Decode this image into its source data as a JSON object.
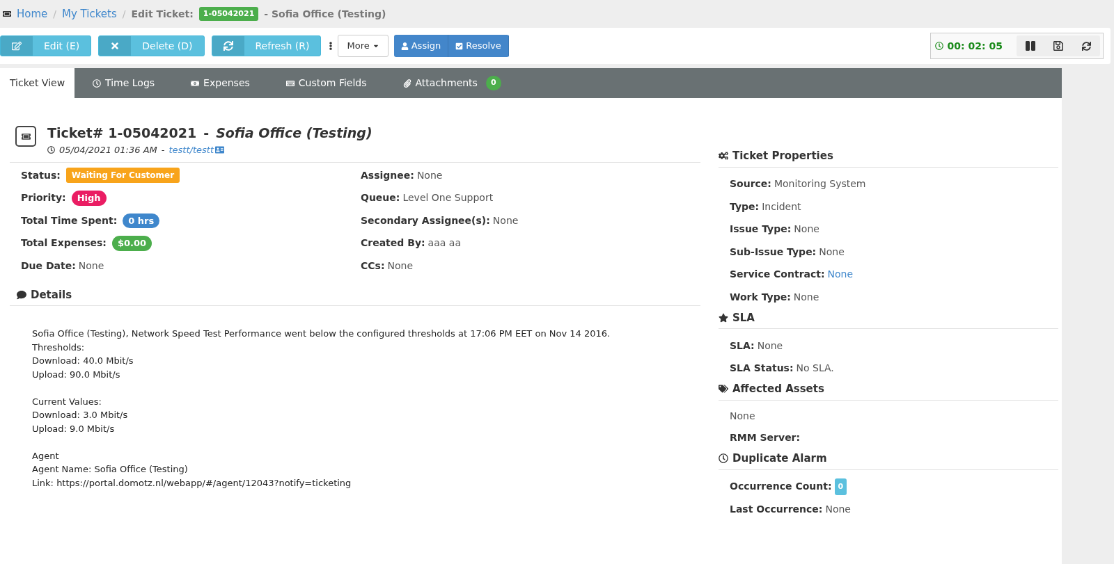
{
  "breadcrumb": {
    "items": [
      {
        "label": "Home",
        "separator": "/"
      },
      {
        "label": "My Tickets",
        "separator": "/"
      }
    ],
    "current_label": "Edit Ticket:",
    "ticket_badge": "1-05042021",
    "current_suffix": "- Sofia Office (Testing)"
  },
  "toolbar": {
    "buttons": [
      {
        "label": "Edit (E)",
        "kind": "edit"
      },
      {
        "label": "Delete (D)",
        "kind": "delete"
      },
      {
        "label": "Refresh (R)",
        "kind": "refresh"
      }
    ],
    "more": "More",
    "actions": [
      {
        "label": "Assign",
        "kind": "assign"
      },
      {
        "label": "Resolve",
        "kind": "resolve"
      }
    ],
    "timer": "00: 02: 05"
  },
  "tabs": [
    {
      "label": "Ticket View",
      "kind": "view",
      "selected": true
    },
    {
      "label": "Time Logs",
      "kind": "time",
      "selected": false
    },
    {
      "label": "Expenses",
      "kind": "money",
      "selected": false
    },
    {
      "label": "Custom Fields",
      "kind": "keyboard",
      "selected": false
    },
    {
      "label": "Attachments",
      "kind": "attach",
      "selected": false,
      "count": "0"
    }
  ],
  "ticket": {
    "title": "Ticket# 1-05042021",
    "separator": "-",
    "subject": "Sofia Office (Testing)",
    "date": "05/04/2021 01:36 AM",
    "date_separator": "-",
    "author": "testt/testt"
  },
  "fields_left": [
    {
      "label": "Status:",
      "value": "Waiting For Customer",
      "kind": "tag",
      "color": "#f8a41b"
    },
    {
      "label": "Priority:",
      "value": "High",
      "kind": "pill",
      "color": "#ea1d63"
    },
    {
      "label": "Total Time Spent:",
      "value": "0 hrs",
      "kind": "pill",
      "color": "#3f87cc"
    },
    {
      "label": "Total Expenses:",
      "value": "$0.00",
      "kind": "pill",
      "color": "#4cae4c"
    },
    {
      "label": "Due Date:",
      "value": "None",
      "kind": "text"
    }
  ],
  "fields_right": [
    {
      "label": "Assignee:",
      "value": "None",
      "kind": "text"
    },
    {
      "label": "Queue:",
      "value": "Level One Support",
      "kind": "text"
    },
    {
      "label": "Secondary Assignee(s):",
      "value": "None",
      "kind": "text"
    },
    {
      "label": "Created By:",
      "value": "aaa aa",
      "kind": "text"
    },
    {
      "label": "CCs:",
      "value": "None",
      "kind": "text"
    }
  ],
  "details": {
    "title": "Details",
    "paragraphs": [
      [
        "Sofia Office (Testing), Network Speed Test Performance went below the configured thresholds at 17:06 PM EET on Nov 14 2016.",
        "Thresholds:",
        "Download: 40.0 Mbit/s",
        "Upload: 90.0 Mbit/s"
      ],
      [
        "Current Values:",
        "Download: 3.0 Mbit/s",
        "Upload: 9.0 Mbit/s"
      ],
      [
        "Agent",
        "Agent Name: Sofia Office (Testing)",
        "Link: https://portal.domotz.nl/webapp/#/agent/12043?notify=ticketing"
      ]
    ]
  },
  "sidebar": [
    {
      "title": "Ticket Properties",
      "kind": "cogs",
      "rows": [
        {
          "label": "Source:",
          "value": "Monitoring System",
          "kind": "text"
        },
        {
          "label": "Type:",
          "value": "Incident",
          "kind": "text"
        },
        {
          "label": "Issue Type:",
          "value": "None",
          "kind": "text"
        },
        {
          "label": "Sub-Issue Type:",
          "value": "None",
          "kind": "text"
        },
        {
          "label": "Service Contract:",
          "value": "None",
          "kind": "link"
        },
        {
          "label": "Work Type:",
          "value": "None",
          "kind": "text"
        }
      ]
    },
    {
      "title": "SLA",
      "kind": "star",
      "rows": [
        {
          "label": "SLA:",
          "value": "None",
          "kind": "text"
        },
        {
          "label": "SLA Status:",
          "value": "No SLA.",
          "kind": "text"
        }
      ]
    },
    {
      "title": "Affected Assets",
      "kind": "tags",
      "rows": [
        {
          "value": "None",
          "kind": "plain"
        },
        {
          "label": "RMM Server:",
          "kind": "label"
        }
      ]
    },
    {
      "title": "Duplicate Alarm",
      "kind": "clock",
      "rows": [
        {
          "label": "Occurrence Count:",
          "value": "0",
          "kind": "count"
        },
        {
          "label": "Last Occurrence:",
          "value": "None",
          "kind": "text"
        }
      ]
    }
  ]
}
